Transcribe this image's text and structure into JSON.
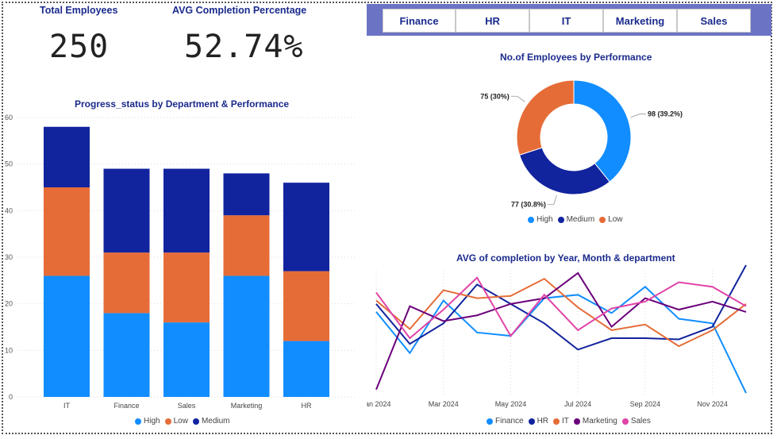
{
  "kpis": {
    "total_employees": {
      "label": "Total Employees",
      "value": "250"
    },
    "avg_completion": {
      "label": "AVG Completion Percentage",
      "value": "52.74%"
    }
  },
  "slicer": {
    "buttons": [
      "Finance",
      "HR",
      "IT",
      "Marketing",
      "Sales"
    ]
  },
  "colors": {
    "High": "#118dff",
    "Low": "#e66c37",
    "Medium": "#12239e",
    "Finance": "#118dff",
    "HR": "#12239e",
    "IT": "#e66c37",
    "Marketing": "#6b007b",
    "Sales": "#e044a7"
  },
  "chart_data": [
    {
      "type": "bar",
      "stacked": true,
      "title": "Progress_status by Department & Performance",
      "categories": [
        "IT",
        "Finance",
        "Sales",
        "Marketing",
        "HR"
      ],
      "series": [
        {
          "name": "High",
          "values": [
            26,
            18,
            16,
            26,
            12
          ]
        },
        {
          "name": "Low",
          "values": [
            19,
            13,
            15,
            13,
            15
          ]
        },
        {
          "name": "Medium",
          "values": [
            13,
            18,
            18,
            9,
            19
          ]
        }
      ],
      "ylim": [
        0,
        60
      ],
      "yticks": [
        0,
        10,
        20,
        30,
        40,
        50,
        60
      ],
      "legend": "bottom-center",
      "grid": true
    },
    {
      "type": "pie",
      "donut": true,
      "title": "No.of Employees by Performance",
      "slices": [
        {
          "name": "High",
          "value": 98,
          "label": "98 (39.2%)"
        },
        {
          "name": "Medium",
          "value": 77,
          "label": "77 (30.8%)"
        },
        {
          "name": "Low",
          "value": 75,
          "label": "75 (30%)"
        }
      ],
      "legend": "bottom-center"
    },
    {
      "type": "line",
      "title": "AVG of completion by Year, Month & department",
      "x": [
        "Jan 2024",
        "Feb 2024",
        "Mar 2024",
        "Apr 2024",
        "May 2024",
        "Jun 2024",
        "Jul 2024",
        "Aug 2024",
        "Sep 2024",
        "Oct 2024",
        "Nov 2024",
        "Dec 2024"
      ],
      "xticks": [
        "Jan 2024",
        "Mar 2024",
        "May 2024",
        "Jul 2024",
        "Sep 2024",
        "Nov 2024"
      ],
      "ylim": [
        0,
        90
      ],
      "series": [
        {
          "name": "Finance",
          "values": [
            73,
            37,
            83,
            55,
            52,
            85,
            88,
            72,
            95,
            67,
            63,
            2
          ]
        },
        {
          "name": "HR",
          "values": [
            80,
            45,
            63,
            97,
            80,
            63,
            40,
            50,
            50,
            49,
            60,
            130
          ]
        },
        {
          "name": "IT",
          "values": [
            83,
            58,
            92,
            85,
            87,
            102,
            77,
            57,
            62,
            43,
            57,
            80
          ]
        },
        {
          "name": "Marketing",
          "values": [
            5,
            78,
            65,
            70,
            80,
            85,
            107,
            60,
            85,
            75,
            82,
            73
          ]
        },
        {
          "name": "Sales",
          "values": [
            90,
            50,
            75,
            103,
            52,
            88,
            57,
            76,
            82,
            99,
            95,
            78
          ]
        }
      ],
      "legend": "bottom-center",
      "grid": true
    }
  ]
}
